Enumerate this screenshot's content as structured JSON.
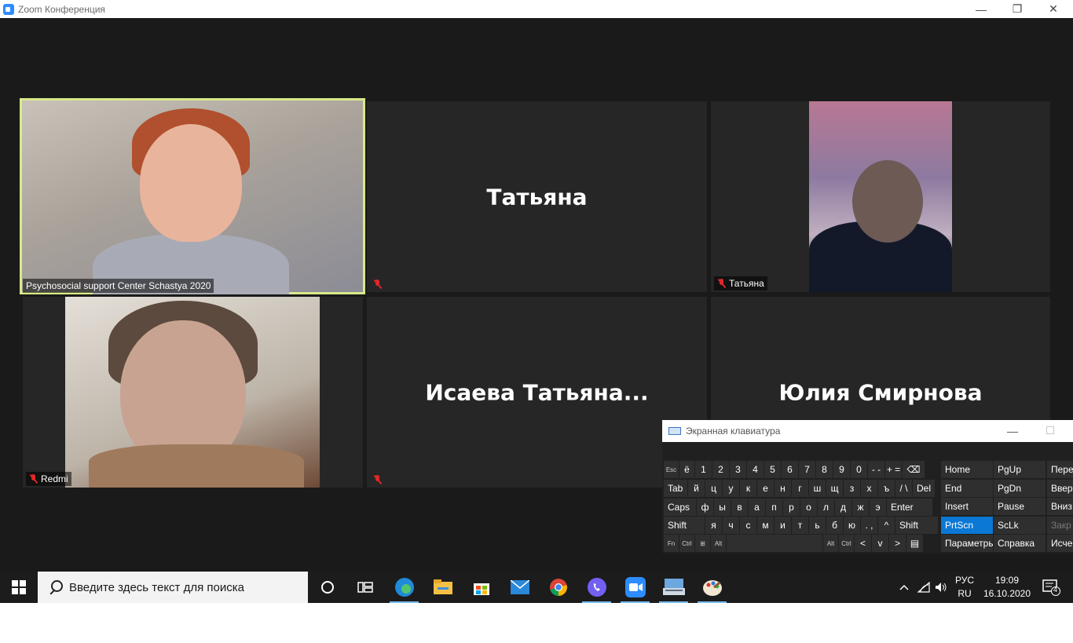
{
  "window": {
    "title": "Zoom Конференция"
  },
  "tiles": [
    {
      "label": "Psychosocial support Center Schastya 2020",
      "muted": false,
      "speaking": true
    },
    {
      "big_name": "Татьяна",
      "muted": true
    },
    {
      "label": "Татьяна",
      "muted": true
    },
    {
      "label": "Redmi",
      "muted": true
    },
    {
      "big_name": "Исаева  Татьяна...",
      "muted": true
    },
    {
      "big_name": "Юлия Смирнова"
    }
  ],
  "osk": {
    "title": "Экранная клавиатура",
    "row1": [
      "Esc",
      "ё",
      "1",
      "2",
      "3",
      "4",
      "5",
      "6",
      "7",
      "8",
      "9",
      "0",
      "- -",
      "+ =",
      "⌫"
    ],
    "row2": [
      "Tab",
      "й",
      "ц",
      "у",
      "к",
      "е",
      "н",
      "г",
      "ш",
      "щ",
      "з",
      "х",
      "ъ",
      "/ \\",
      "Del"
    ],
    "row3": [
      "Caps",
      "ф",
      "ы",
      "в",
      "а",
      "п",
      "р",
      "о",
      "л",
      "д",
      "ж",
      "э",
      "Enter"
    ],
    "row4": [
      "Shift",
      "я",
      "ч",
      "с",
      "м",
      "и",
      "т",
      "ь",
      "б",
      "ю",
      ". ,",
      "^",
      "Shift"
    ],
    "row5": [
      "Fn",
      "Ctrl",
      "⊞",
      "Alt",
      "",
      "Alt",
      "Ctrl",
      "<",
      "v",
      ">",
      "▤"
    ],
    "nav": [
      [
        "Home",
        "PgUp",
        "Пере"
      ],
      [
        "End",
        "PgDn",
        "Ввер"
      ],
      [
        "Insert",
        "Pause",
        "Вниз"
      ],
      [
        "PrtScn",
        "ScLk",
        "Закр"
      ],
      [
        "Параметры",
        "Справка",
        "Исче"
      ]
    ]
  },
  "taskbar": {
    "search_placeholder": "Введите здесь текст для поиска",
    "apps": [
      "cortana-icon",
      "task-view-icon",
      "edge-icon",
      "file-explorer-icon",
      "store-icon",
      "mail-icon",
      "chrome-icon",
      "viber-icon",
      "zoom-icon",
      "on-screen-keyboard-icon",
      "paint-icon"
    ],
    "lang_top": "РУС",
    "lang_bottom": "RU",
    "time": "19:09",
    "date": "16.10.2020",
    "notifications": "4"
  }
}
